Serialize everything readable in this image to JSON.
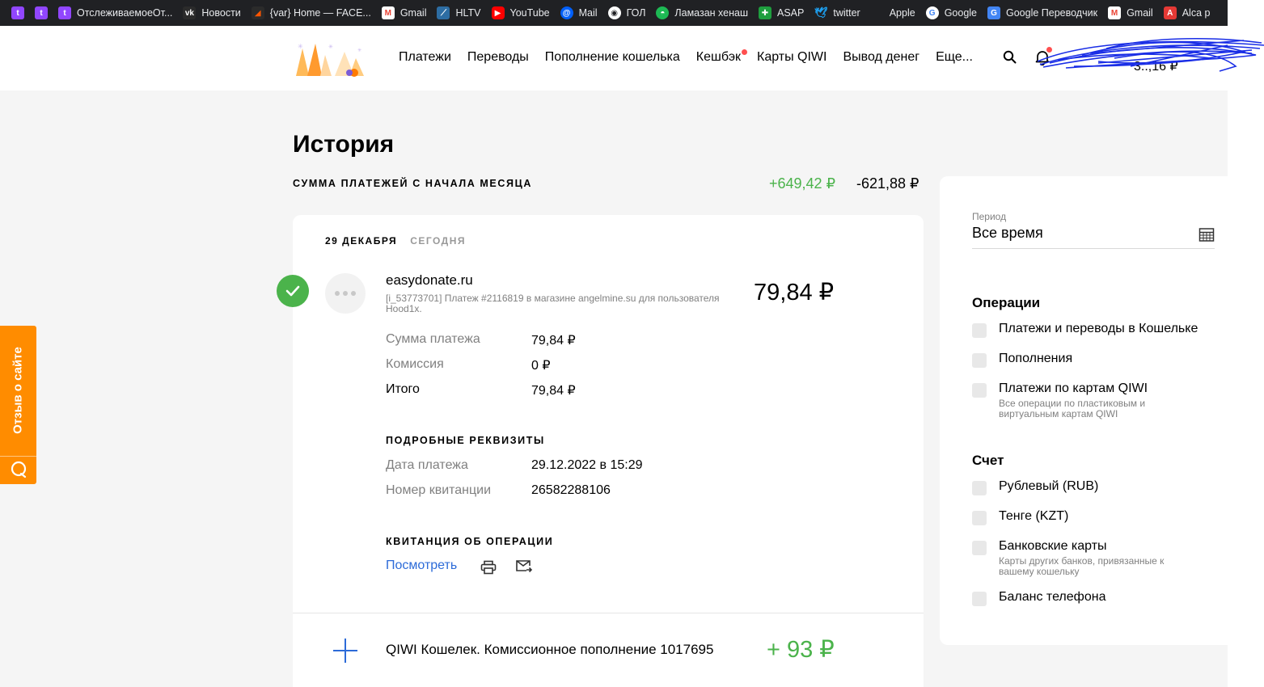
{
  "bookmarks": [
    {
      "label": "",
      "icon": "twitch-icon",
      "color": "#9146ff"
    },
    {
      "label": "",
      "icon": "twitch-icon",
      "color": "#9146ff"
    },
    {
      "label": "ОтслеживаемоеОт...",
      "icon": "twitch-icon",
      "color": "#9146ff"
    },
    {
      "label": "Новости",
      "icon": "vk-icon",
      "color": "#2b2b2b"
    },
    {
      "label": "{var} Home — FACE...",
      "icon": "faceit-icon",
      "color": "#ff5500"
    },
    {
      "label": "Gmail",
      "icon": "gmail-icon",
      "color": "#ffffff"
    },
    {
      "label": "HLTV",
      "icon": "hltv-icon",
      "color": "#2d6da3"
    },
    {
      "label": "YouTube",
      "icon": "youtube-icon",
      "color": "#ff0000"
    },
    {
      "label": "Mail",
      "icon": "mail-ru-icon",
      "color": "#005ff9"
    },
    {
      "label": "ГОЛ",
      "icon": "gol-icon",
      "color": "#ffffff"
    },
    {
      "label": "Ламазан хенаш",
      "icon": "globe-icon",
      "color": "#1db954"
    },
    {
      "label": "ASAP",
      "icon": "asap-icon",
      "color": "#1e9e3e"
    },
    {
      "label": "twitter",
      "icon": "twitter-icon",
      "color": "#1da1f2"
    },
    {
      "label": "Apple",
      "icon": "apple-icon",
      "color": "#a0a0a0"
    },
    {
      "label": "Google",
      "icon": "google-icon",
      "color": "#ffffff"
    },
    {
      "label": "Google Переводчик",
      "icon": "translate-icon",
      "color": "#4285f4"
    },
    {
      "label": "Gmail",
      "icon": "gmail-icon",
      "color": "#ffffff"
    },
    {
      "label": "Alca p",
      "icon": "alca-icon",
      "color": "#e53935"
    }
  ],
  "header": {
    "nav": [
      {
        "label": "Платежи",
        "dot": false
      },
      {
        "label": "Переводы",
        "dot": false
      },
      {
        "label": "Пополнение кошелька",
        "dot": false
      },
      {
        "label": "Кешбэк",
        "dot": true
      },
      {
        "label": "Карты QIWI",
        "dot": false
      },
      {
        "label": "Вывод денег",
        "dot": false
      },
      {
        "label": "Еще...",
        "dot": false
      }
    ],
    "balance": "3..,16 ₽"
  },
  "page": {
    "title": "История",
    "sum_label": "СУММА ПЛАТЕЖЕЙ С НАЧАЛА МЕСЯЦА",
    "sum_plus": "+649,42 ₽",
    "sum_minus": "-621,88 ₽"
  },
  "history": {
    "date": "29 ДЕКАБРЯ",
    "today": "СЕГОДНЯ",
    "tx1": {
      "title": "easydonate.ru",
      "description": "[i_53773701] Платеж #2116819 в магазине angelmine.su для пользователя Hood1x.",
      "amount": "79,84 ₽",
      "rows": [
        {
          "label": "Сумма платежа",
          "value": "79,84 ₽"
        },
        {
          "label": "Комиссия",
          "value": "0 ₽"
        },
        {
          "label": "Итого",
          "value": "79,84 ₽"
        }
      ],
      "details_head": "ПОДРОБНЫЕ РЕКВИЗИТЫ",
      "details": [
        {
          "label": "Дата платежа",
          "value": "29.12.2022 в 15:29"
        },
        {
          "label": "Номер квитанции",
          "value": "26582288106"
        }
      ],
      "receipt_head": "КВИТАНЦИЯ ОБ ОПЕРАЦИИ",
      "receipt_link": "Посмотреть"
    },
    "tx2": {
      "title": "QIWI Кошелек. Комиссионное пополнение 1017695",
      "amount": "+ 93 ₽"
    }
  },
  "filter": {
    "period_label": "Период",
    "period_value": "Все время",
    "ops_head": "Операции",
    "ops": [
      {
        "label": "Платежи и переводы в Кошельке",
        "sub": ""
      },
      {
        "label": "Пополнения",
        "sub": ""
      },
      {
        "label": "Платежи по картам QIWI",
        "sub": "Все операции по пластиковым и виртуальным картам QIWI"
      }
    ],
    "acc_head": "Счет",
    "accounts": [
      {
        "label": "Рублевый (RUB)",
        "sub": ""
      },
      {
        "label": "Тенге (KZT)",
        "sub": ""
      },
      {
        "label": "Банковские карты",
        "sub": "Карты других банков, привязанные к вашему кошельку"
      },
      {
        "label": "Баланс телефона",
        "sub": ""
      }
    ]
  },
  "feedback": {
    "label": "Отзыв о сайте"
  },
  "colors": {
    "green": "#4bb34b",
    "orange": "#ff8c00",
    "link": "#2c6bd8",
    "bookmarks_bg": "#202124"
  }
}
